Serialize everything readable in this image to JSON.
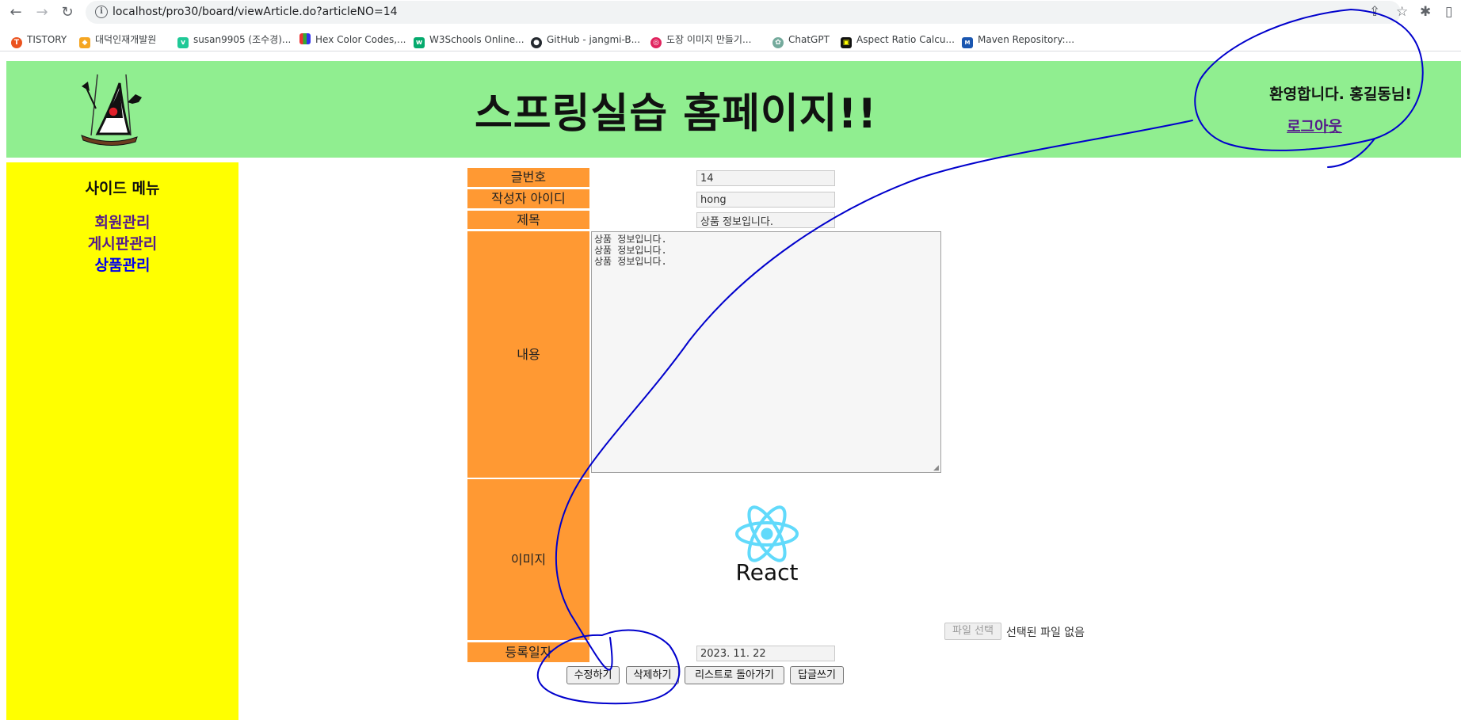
{
  "browser": {
    "url": "localhost/pro30/board/viewArticle.do?articleNO=14",
    "bookmarks": [
      {
        "label": "TISTORY",
        "color": "#eb531f",
        "glyph": "T"
      },
      {
        "label": "대덕인재개발원",
        "color": "#f5a623",
        "glyph": "◆"
      },
      {
        "label": "susan9905 (조수경)...",
        "color": "#20c997",
        "glyph": "v"
      },
      {
        "label": "Hex Color Codes,...",
        "color": "#6f42c1",
        "glyph": "▮"
      },
      {
        "label": "W3Schools Online...",
        "color": "#04aa6d",
        "glyph": "w"
      },
      {
        "label": "GitHub - jangmi-B...",
        "color": "#24292f",
        "glyph": "●"
      },
      {
        "label": "도장 이미지 만들기...",
        "color": "#e0245e",
        "glyph": "◎"
      },
      {
        "label": "ChatGPT",
        "color": "#74aa9c",
        "glyph": "✿"
      },
      {
        "label": "Aspect Ratio Calcu...",
        "color": "#111111",
        "glyph": "▣"
      },
      {
        "label": "Maven Repository:...",
        "color": "#1a56b0",
        "glyph": "M"
      }
    ]
  },
  "header": {
    "title": "스프링실습 홈페이지!!",
    "welcome": "환영합니다. 홍길동님!",
    "logout": "로그아웃"
  },
  "sidebar": {
    "title": "사이드 메뉴",
    "links": [
      {
        "label": "회원관리",
        "color": "#551a8b"
      },
      {
        "label": "게시판관리",
        "color": "#551a8b"
      },
      {
        "label": "상품관리",
        "color": "#0000ee"
      }
    ]
  },
  "article": {
    "labels": {
      "no": "글번호",
      "writer": "작성자 아이디",
      "title": "제목",
      "content": "내용",
      "image": "이미지",
      "date": "등록일자"
    },
    "values": {
      "no": "14",
      "writer": "hong",
      "title": "상품 정보입니다.",
      "content": "상품 정보입니다.\n상품 정보입니다.\n상품 정보입니다.",
      "date": "2023. 11. 22"
    },
    "image_caption": "React",
    "file_button": "파일 선택",
    "file_status": "선택된 파일 없음"
  },
  "buttons": {
    "edit": "수정하기",
    "delete": "삭제하기",
    "list": "리스트로 돌아가기",
    "reply": "답글쓰기"
  },
  "colors": {
    "header_bg": "#90ee90",
    "sidebar_bg": "#ffff00",
    "label_bg": "#ff9933",
    "annotation": "#0000cc"
  }
}
